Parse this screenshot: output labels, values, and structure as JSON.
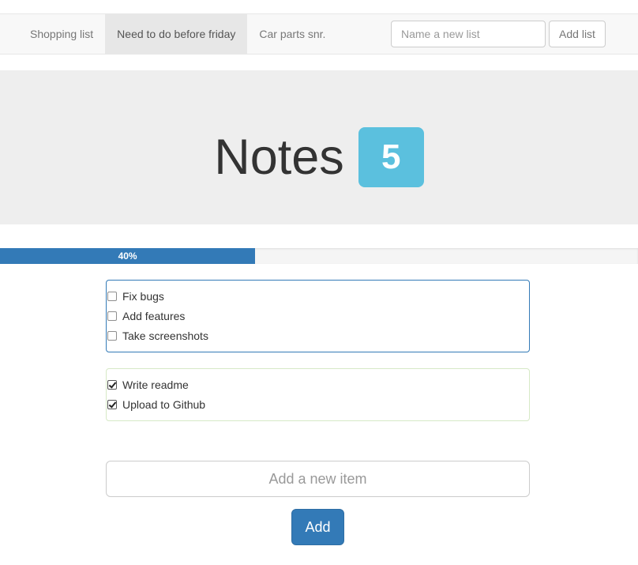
{
  "navbar": {
    "tabs": [
      {
        "label": "Shopping list",
        "active": false
      },
      {
        "label": "Need to do before friday",
        "active": true
      },
      {
        "label": "Car parts snr.",
        "active": false
      }
    ],
    "new_list_placeholder": "Name a new list",
    "add_list_label": "Add list"
  },
  "header": {
    "title": "Notes",
    "badge_count": "5",
    "badge_color": "#5bc0de"
  },
  "progress": {
    "label": "40%",
    "value": 0.4,
    "color": "#337ab7"
  },
  "todo_items": [
    {
      "label": "Fix bugs",
      "checked": false
    },
    {
      "label": "Add features",
      "checked": false
    },
    {
      "label": "Take screenshots",
      "checked": false
    }
  ],
  "done_items": [
    {
      "label": "Write readme",
      "checked": true
    },
    {
      "label": "Upload to Github",
      "checked": true
    }
  ],
  "add_item": {
    "placeholder": "Add a new item",
    "button_label": "Add",
    "button_color": "#337ab7"
  }
}
